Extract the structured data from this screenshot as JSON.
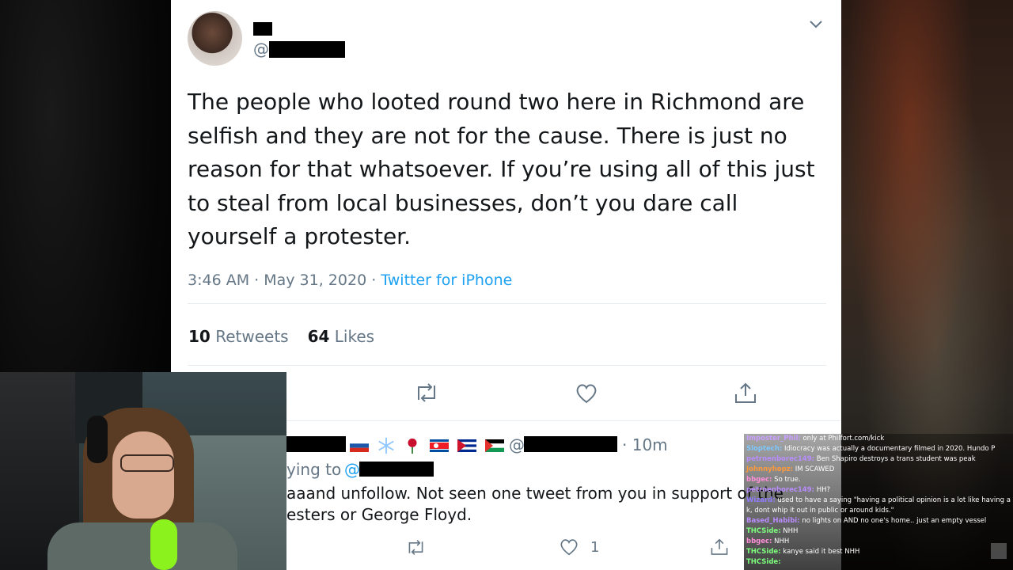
{
  "tweet": {
    "handle_prefix": "@",
    "text": "The people who looted round two here in Richmond are selfish and they are not for the cause. There is just no reason for that whatsoever. If you’re using all of this just to steal from local businesses, don’t you dare call yourself a protester.",
    "time": "3:46 AM",
    "date": "May 31, 2020",
    "separator": " · ",
    "source": "Twitter for iPhone",
    "retweets_count": "10",
    "retweets_label": "Retweets",
    "likes_count": "64",
    "likes_label": "Likes"
  },
  "reply": {
    "handle_prefix": "@",
    "time": "· 10m",
    "replying_label": "ying to",
    "replying_at": "@",
    "text_line1": "aaand unfollow. Not seen one tweet from you in support of the",
    "text_line2": "esters or George Floyd.",
    "like_count": "1"
  },
  "colors": {
    "accent": "#1da1f2",
    "text": "#14171a",
    "muted": "#657786",
    "divider": "#e6ecf0"
  },
  "chat": [
    {
      "user": "Imposter_Phil:",
      "msg": "only at Philfort.com/kick",
      "color": "#c9a0ff"
    },
    {
      "user": "Sloptech:",
      "msg": "Idiocracy was actually a documentary filmed in 2020. Hundo P",
      "color": "#7ec8ff"
    },
    {
      "user": "petrnenborec149:",
      "msg": "Ben Shapiro destroys a trans student was peak",
      "color": "#b98cff"
    },
    {
      "user": "Johnnyhopz:",
      "msg": "IM SCAWED",
      "color": "#ff9a3c"
    },
    {
      "user": "bbgec:",
      "msg": "So true.",
      "color": "#ff8fd8"
    },
    {
      "user": "petrnenborec149:",
      "msg": "HH?",
      "color": "#b98cff"
    },
    {
      "user": "Wizard:",
      "msg": "used to have a saying \"having a political opinion is a lot like having a",
      "color": "#8f7cff"
    },
    {
      "user": "",
      "msg": "k, dont whip it out in public or around kids.\"",
      "color": "#ffffff"
    },
    {
      "user": "Based_Habibi:",
      "msg": "no lights on AND no one's home.. just an empty vessel",
      "color": "#b98cff"
    },
    {
      "user": "THCSide:",
      "msg": "NHH",
      "color": "#7dff7d"
    },
    {
      "user": "bbgec:",
      "msg": "NHH",
      "color": "#ff8fd8"
    },
    {
      "user": "THCSide:",
      "msg": "kanye said it best NHH",
      "color": "#7dff7d"
    },
    {
      "user": "THCSide:",
      "msg": "",
      "color": "#7dff7d"
    }
  ]
}
